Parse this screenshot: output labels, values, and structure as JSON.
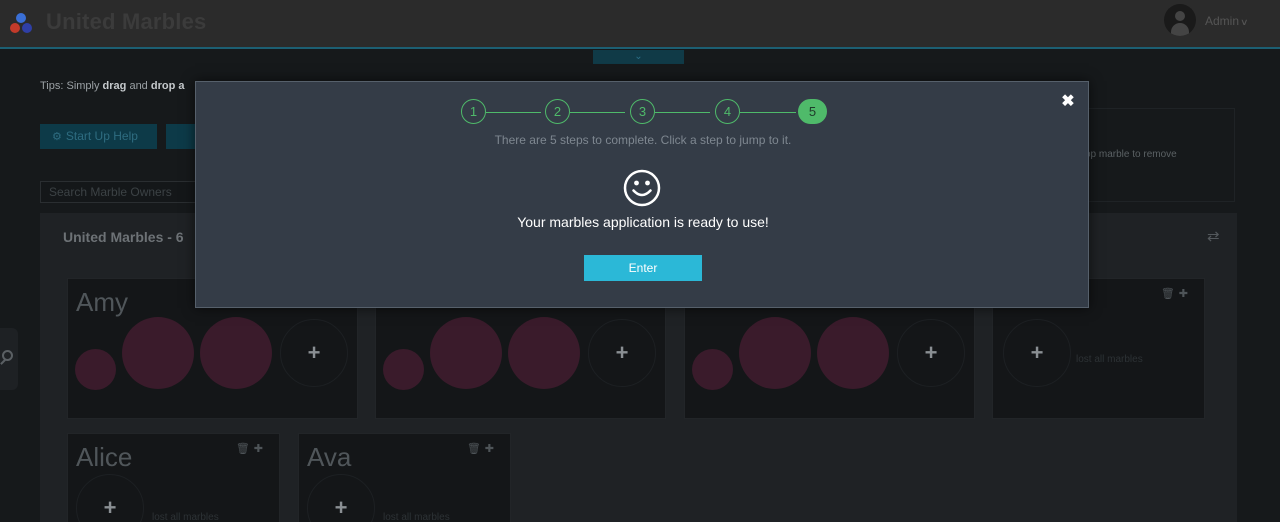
{
  "header": {
    "brand": "United Marbles",
    "user": "Admin"
  },
  "page": {
    "tips_prefix": "Tips: Simply ",
    "tips_bold1": "drag",
    "tips_mid": " and ",
    "tips_bold2": "drop a",
    "start_up_help": "Start Up Help",
    "search_placeholder": "Search Marble Owners",
    "hint_text": "op marble to remove",
    "panel_title": "United Marbles -  6"
  },
  "cards": [
    {
      "name": "Amy"
    },
    {
      "name": "Alice"
    },
    {
      "name": "Ava"
    }
  ],
  "lost_text": "lost all marbles",
  "modal": {
    "steps": [
      "1",
      "2",
      "3",
      "4",
      "5"
    ],
    "active_step": "5",
    "steps_hint": "There are 5 steps to complete. Click a step to jump to it.",
    "message": "Your marbles application is ready to use!",
    "enter_label": "Enter",
    "accent_color": "#4fba6a",
    "button_color": "#2bb8d7"
  }
}
